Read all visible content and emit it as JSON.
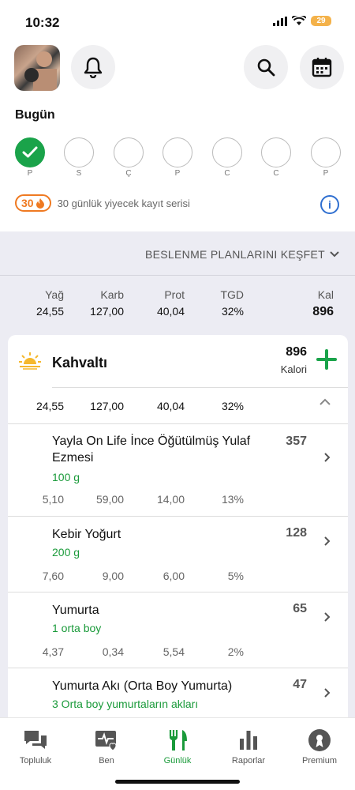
{
  "status": {
    "time": "10:32",
    "battery": "29"
  },
  "header": {
    "avatar_icon": "user-photo",
    "bell_icon": "bell-icon",
    "search_icon": "search-icon",
    "calendar_icon": "calendar-icon"
  },
  "today": {
    "title": "Bugün",
    "days": [
      {
        "label": "P",
        "done": true
      },
      {
        "label": "S",
        "done": false
      },
      {
        "label": "Ç",
        "done": false
      },
      {
        "label": "P",
        "done": false
      },
      {
        "label": "C",
        "done": false
      },
      {
        "label": "C",
        "done": false
      },
      {
        "label": "P",
        "done": false
      }
    ]
  },
  "streak": {
    "count": "30",
    "text": "30 günlük yiyecek kayıt serisi"
  },
  "explore": {
    "label": "BESLENME PLANLARINI KEŞFET"
  },
  "summary": {
    "fat_label": "Yağ",
    "fat": "24,55",
    "carb_label": "Karb",
    "carb": "127,00",
    "prot_label": "Prot",
    "prot": "40,04",
    "rdi_label": "TGD",
    "rdi": "32%",
    "kcal_label": "Kal",
    "kcal": "896"
  },
  "meal": {
    "title": "Kahvaltı",
    "kcal": "896",
    "kcal_label": "Kalori",
    "fat": "24,55",
    "carb": "127,00",
    "prot": "40,04",
    "rdi": "32%"
  },
  "foods": [
    {
      "name": "Yayla On Life İnce Öğütülmüş Yulaf Ezmesi",
      "portion": "100 g",
      "kcal": "357",
      "fat": "5,10",
      "carb": "59,00",
      "prot": "14,00",
      "rdi": "13%"
    },
    {
      "name": "Kebir Yoğurt",
      "portion": "200 g",
      "kcal": "128",
      "fat": "7,60",
      "carb": "9,00",
      "prot": "6,00",
      "rdi": "5%"
    },
    {
      "name": "Yumurta",
      "portion": "1 orta boy",
      "kcal": "65",
      "fat": "4,37",
      "carb": "0,34",
      "prot": "5,54",
      "rdi": "2%"
    },
    {
      "name": "Yumurta Akı (Orta Boy Yumurta)",
      "portion": "3 Orta boy yumurtaların akları",
      "kcal": "47"
    }
  ],
  "nav": [
    {
      "label": "Topluluk",
      "icon": "chat-icon"
    },
    {
      "label": "Ben",
      "icon": "heart-monitor-icon"
    },
    {
      "label": "Günlük",
      "icon": "fork-knife-icon",
      "active": true
    },
    {
      "label": "Raporlar",
      "icon": "bar-chart-icon"
    },
    {
      "label": "Premium",
      "icon": "premium-icon"
    }
  ],
  "colors": {
    "accent_green": "#1aa34a",
    "streak_orange": "#ef7a22",
    "info_blue": "#2f6fd0"
  }
}
